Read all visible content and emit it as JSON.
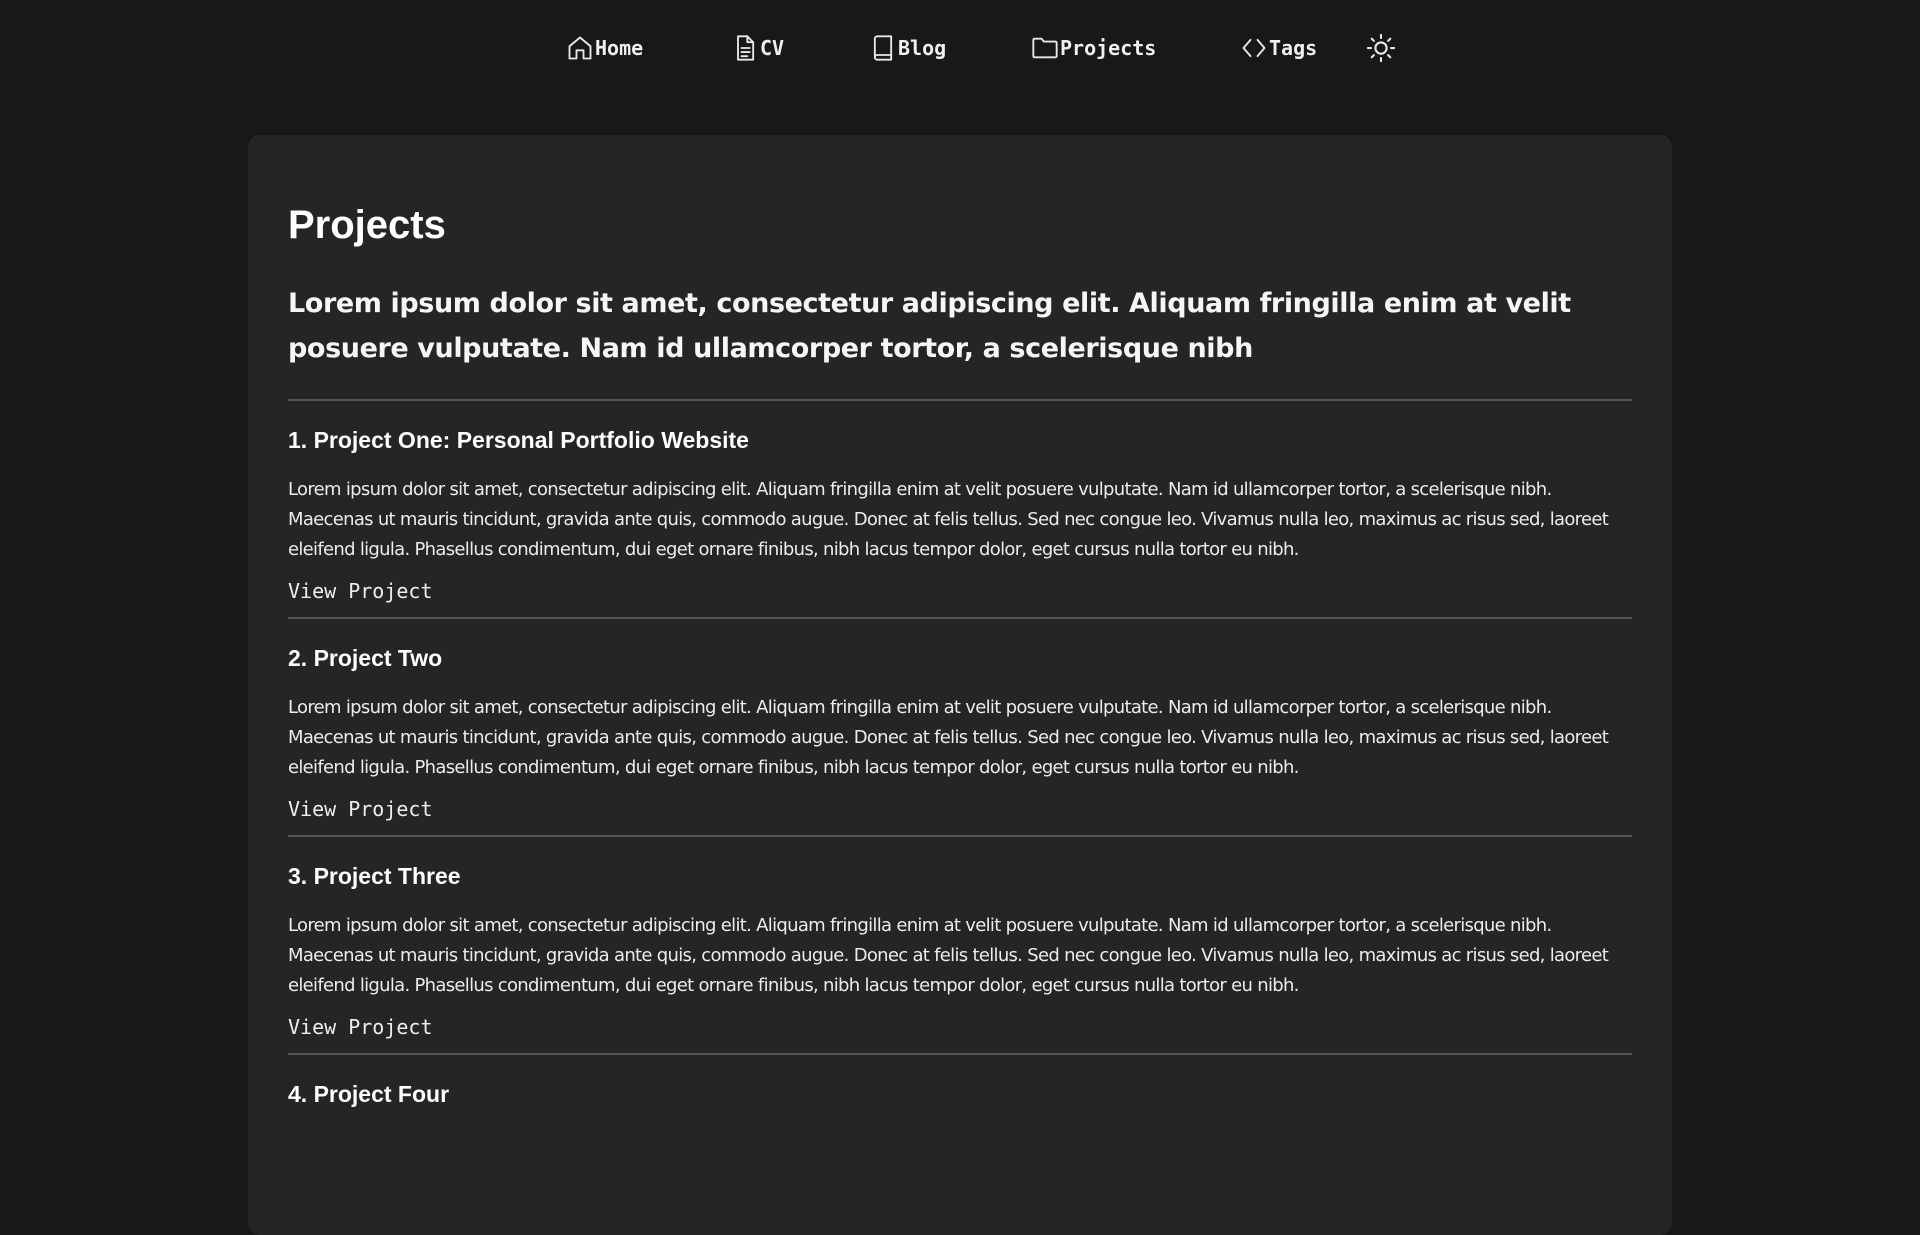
{
  "nav": {
    "items": [
      {
        "label": "Home",
        "icon": "home-icon"
      },
      {
        "label": "CV",
        "icon": "document-icon"
      },
      {
        "label": "Blog",
        "icon": "book-icon"
      },
      {
        "label": "Projects",
        "icon": "folder-icon"
      },
      {
        "label": "Tags",
        "icon": "code-icon"
      }
    ],
    "theme_toggle_icon": "sun-icon"
  },
  "page": {
    "title": "Projects",
    "lead": "Lorem ipsum dolor sit amet, consectetur adipiscing elit. Aliquam fringilla enim at velit posuere vulputate. Nam id ullamcorper tortor, a scelerisque nibh"
  },
  "projects": [
    {
      "title": "1. Project One: Personal Portfolio Website",
      "description": "Lorem ipsum dolor sit amet, consectetur adipiscing elit. Aliquam fringilla enim at velit posuere vulputate. Nam id ullamcorper tortor, a scelerisque nibh. Maecenas ut mauris tincidunt, gravida ante quis, commodo augue. Donec at felis tellus. Sed nec congue leo. Vivamus nulla leo, maximus ac risus sed, laoreet eleifend ligula. Phasellus condimentum, dui eget ornare finibus, nibh lacus tempor dolor, eget cursus nulla tortor eu nibh.",
      "link_label": "View Project"
    },
    {
      "title": "2. Project Two",
      "description": "Lorem ipsum dolor sit amet, consectetur adipiscing elit. Aliquam fringilla enim at velit posuere vulputate. Nam id ullamcorper tortor, a scelerisque nibh. Maecenas ut mauris tincidunt, gravida ante quis, commodo augue. Donec at felis tellus. Sed nec congue leo. Vivamus nulla leo, maximus ac risus sed, laoreet eleifend ligula. Phasellus condimentum, dui eget ornare finibus, nibh lacus tempor dolor, eget cursus nulla tortor eu nibh.",
      "link_label": "View Project"
    },
    {
      "title": "3. Project Three",
      "description": "Lorem ipsum dolor sit amet, consectetur adipiscing elit. Aliquam fringilla enim at velit posuere vulputate. Nam id ullamcorper tortor, a scelerisque nibh. Maecenas ut mauris tincidunt, gravida ante quis, commodo augue. Donec at felis tellus. Sed nec congue leo. Vivamus nulla leo, maximus ac risus sed, laoreet eleifend ligula. Phasellus condimentum, dui eget ornare finibus, nibh lacus tempor dolor, eget cursus nulla tortor eu nibh.",
      "link_label": "View Project"
    },
    {
      "title": "4. Project Four"
    }
  ],
  "colors": {
    "background": "#181818",
    "card": "#252525",
    "divider": "#565656",
    "text": "#f2f2f2"
  }
}
